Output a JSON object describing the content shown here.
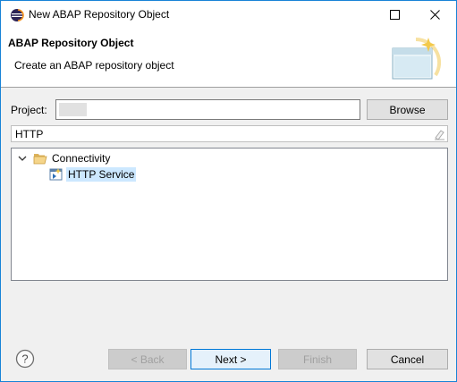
{
  "window": {
    "title": "New ABAP Repository Object"
  },
  "banner": {
    "title": "ABAP Repository Object",
    "description": "Create an ABAP repository object"
  },
  "project": {
    "label": "Project:",
    "value": "",
    "browse_label": "Browse"
  },
  "filter": {
    "value": "HTTP"
  },
  "tree": {
    "items": [
      {
        "label": "Connectivity",
        "expanded": true,
        "icon": "folder-open-icon"
      },
      {
        "label": "HTTP Service",
        "selected": true,
        "icon": "http-service-icon"
      }
    ]
  },
  "buttons": {
    "back": "< Back",
    "next": "Next >",
    "finish": "Finish",
    "cancel": "Cancel"
  },
  "colors": {
    "accent": "#0078d7",
    "selection": "#cce8ff",
    "window_border": "#1883d7"
  }
}
